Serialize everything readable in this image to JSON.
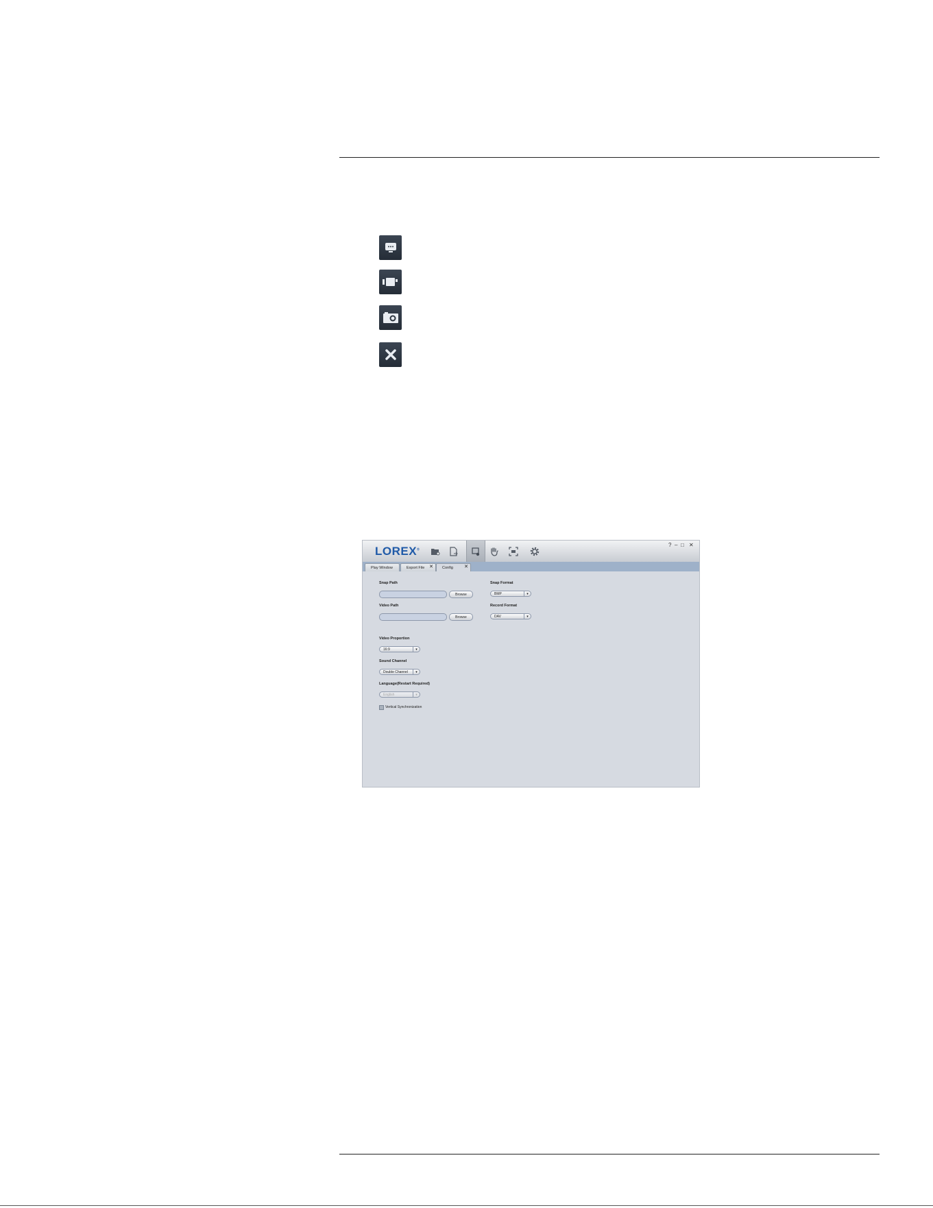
{
  "document": {
    "icons": [
      "monitor-chat-icon",
      "video-camera-icon",
      "camera-icon",
      "close-icon"
    ]
  },
  "app": {
    "logo": "LOREX",
    "logo_mark": "®",
    "toolbar_icons": [
      "folder-icon",
      "export-file-icon",
      "config-icon",
      "hand-icon",
      "fullscreen-icon",
      "gear-icon"
    ],
    "window_controls": {
      "help": "?",
      "minimize": "–",
      "maximize": "□",
      "close": "✕"
    },
    "tabs": [
      {
        "label": "Play Window",
        "close": ""
      },
      {
        "label": "Export File",
        "close": "✕"
      },
      {
        "label": "Config",
        "close": "✕"
      }
    ],
    "config": {
      "snap_path_label": "Snap Path",
      "snap_path_value": "",
      "video_path_label": "Video Path",
      "video_path_value": "",
      "browse_label": "Browse",
      "snap_format_label": "Snap Format",
      "snap_format_value": "BMP",
      "record_format_label": "Record Format",
      "record_format_value": "DAV",
      "video_proportion_label": "Video Proportion",
      "video_proportion_value": "16:9",
      "sound_channel_label": "Sound Channel",
      "sound_channel_value": "Double Channel",
      "language_label": "Language(Restart Required)",
      "language_value": "English",
      "vsync_label": "Vertical Synchronization",
      "dropdown_arrow": "▾"
    }
  }
}
